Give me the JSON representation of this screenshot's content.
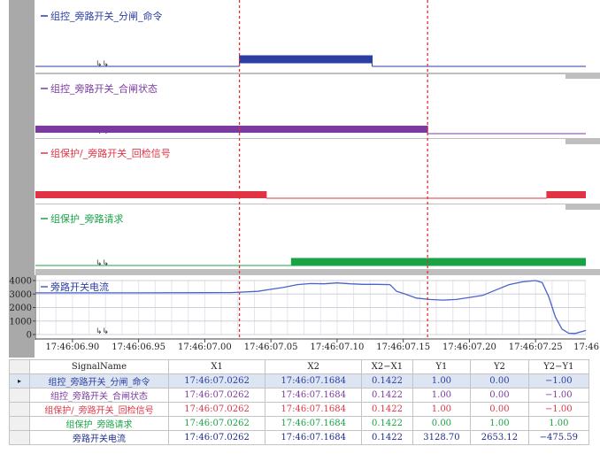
{
  "colors": {
    "cmd": "#2a3ea3",
    "status": "#7b3aa0",
    "protect": "#e03445",
    "request": "#1aa346",
    "current": "#4a63c9",
    "cursor": "#e03030",
    "separator": "#bfbfbf",
    "left_strip": "#a9a9a9",
    "axis": "#444444"
  },
  "icons": [
    "marker-arrows-icon",
    "row-pointer-icon"
  ],
  "chart_data": {
    "type": "line",
    "cursors": {
      "x1": "17:46:07.0262",
      "x2": "17:46:07.1684"
    },
    "x_axis": {
      "range": [
        6.872,
        7.288
      ],
      "ticks": [
        6.9,
        6.95,
        7.0,
        7.05,
        7.1,
        7.15,
        7.2,
        7.25
      ],
      "tick_labels": [
        "17:46:06.90",
        "17:46:06.95",
        "17:46:07.00",
        "17:46:07.05",
        "17:46:07.10",
        "17:46:07.15",
        "17:46:07.20",
        "17:46:07.25",
        "17:46"
      ]
    },
    "digital_series": [
      {
        "name": "组控_旁路开关_分闸_命令",
        "color_key": "cmd",
        "segments": [
          [
            6.872,
            7.0262,
            0
          ],
          [
            7.0262,
            7.1265,
            1
          ],
          [
            7.1265,
            7.288,
            0
          ]
        ]
      },
      {
        "name": "组控_旁路开关_合闸状态",
        "color_key": "status",
        "segments": [
          [
            6.872,
            7.1684,
            1
          ],
          [
            7.1684,
            7.288,
            0
          ]
        ]
      },
      {
        "name": "组保护/_旁路开关_回检信号",
        "color_key": "protect",
        "segments": [
          [
            6.872,
            7.0465,
            1
          ],
          [
            7.0465,
            7.2585,
            0
          ],
          [
            7.2585,
            7.288,
            1
          ]
        ]
      },
      {
        "name": "组保护_旁路请求",
        "color_key": "request",
        "segments": [
          [
            6.872,
            7.0655,
            0
          ],
          [
            7.0655,
            7.288,
            1
          ]
        ]
      }
    ],
    "analog_series": {
      "name": "旁路开关电流",
      "color_key": "current",
      "ylim": [
        0,
        4000
      ],
      "y_ticks": [
        0,
        1000,
        2000,
        3000,
        4000
      ],
      "x": [
        6.872,
        6.9,
        6.95,
        7.0,
        7.02,
        7.04,
        7.05,
        7.06,
        7.07,
        7.08,
        7.09,
        7.1,
        7.11,
        7.12,
        7.13,
        7.14,
        7.145,
        7.15,
        7.16,
        7.17,
        7.18,
        7.19,
        7.2,
        7.21,
        7.22,
        7.23,
        7.24,
        7.25,
        7.255,
        7.26,
        7.265,
        7.27,
        7.275,
        7.28,
        7.288
      ],
      "y": [
        3090,
        3090,
        3090,
        3100,
        3110,
        3200,
        3350,
        3500,
        3700,
        3780,
        3760,
        3820,
        3760,
        3720,
        3720,
        3700,
        3200,
        3050,
        2700,
        2600,
        2550,
        2600,
        2750,
        2900,
        3300,
        3700,
        3900,
        4000,
        3850,
        2800,
        1300,
        400,
        100,
        80,
        300
      ]
    },
    "table": {
      "columns": [
        "SignalName",
        "X1",
        "X2",
        "X2−X1",
        "Y1",
        "Y2",
        "Y2−Y1"
      ],
      "rows": [
        [
          "组控_旁路开关_分闸_命令",
          "17:46:07.0262",
          "17:46:07.1684",
          "0.1422",
          "1.00",
          "0.00",
          "−1.00"
        ],
        [
          "组控_旁路开关_合闸状态",
          "17:46:07.0262",
          "17:46:07.1684",
          "0.1422",
          "1.00",
          "0.00",
          "−1.00"
        ],
        [
          "组保护/_旁路开关_回检信号",
          "17:46:07.0262",
          "17:46:07.1684",
          "0.1422",
          "1.00",
          "0.00",
          "−1.00"
        ],
        [
          "组保护_旁路请求",
          "17:46:07.0262",
          "17:46:07.1684",
          "0.1422",
          "0.00",
          "1.00",
          "1.00"
        ],
        [
          "旁路开关电流",
          "17:46:07.0262",
          "17:46:07.1684",
          "0.1422",
          "3128.70",
          "2653.12",
          "−475.59"
        ]
      ]
    }
  }
}
